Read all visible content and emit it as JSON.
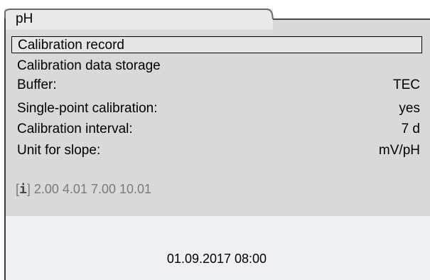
{
  "tab": {
    "label": "pH"
  },
  "menu": {
    "items": [
      {
        "label": "Calibration record",
        "value": ""
      },
      {
        "label": "Calibration data storage",
        "value": ""
      },
      {
        "label": "Buffer:",
        "value": "TEC"
      },
      {
        "label": "Single-point calibration:",
        "value": "yes"
      },
      {
        "label": "Calibration interval:",
        "value": "7 d"
      },
      {
        "label": "Unit for slope:",
        "value": "mV/pH"
      }
    ]
  },
  "info": {
    "open_bracket": "[",
    "icon_glyph": "i",
    "close_bracket": "]",
    "text": "2.00 4.01 7.00 10.01"
  },
  "status": {
    "datetime": "01.09.2017 08:00"
  },
  "colors": {
    "panel": "#d9d9d9",
    "footer": "#eef0f4",
    "tab": "#e9e9e9",
    "info_text": "#7a7a7a"
  }
}
